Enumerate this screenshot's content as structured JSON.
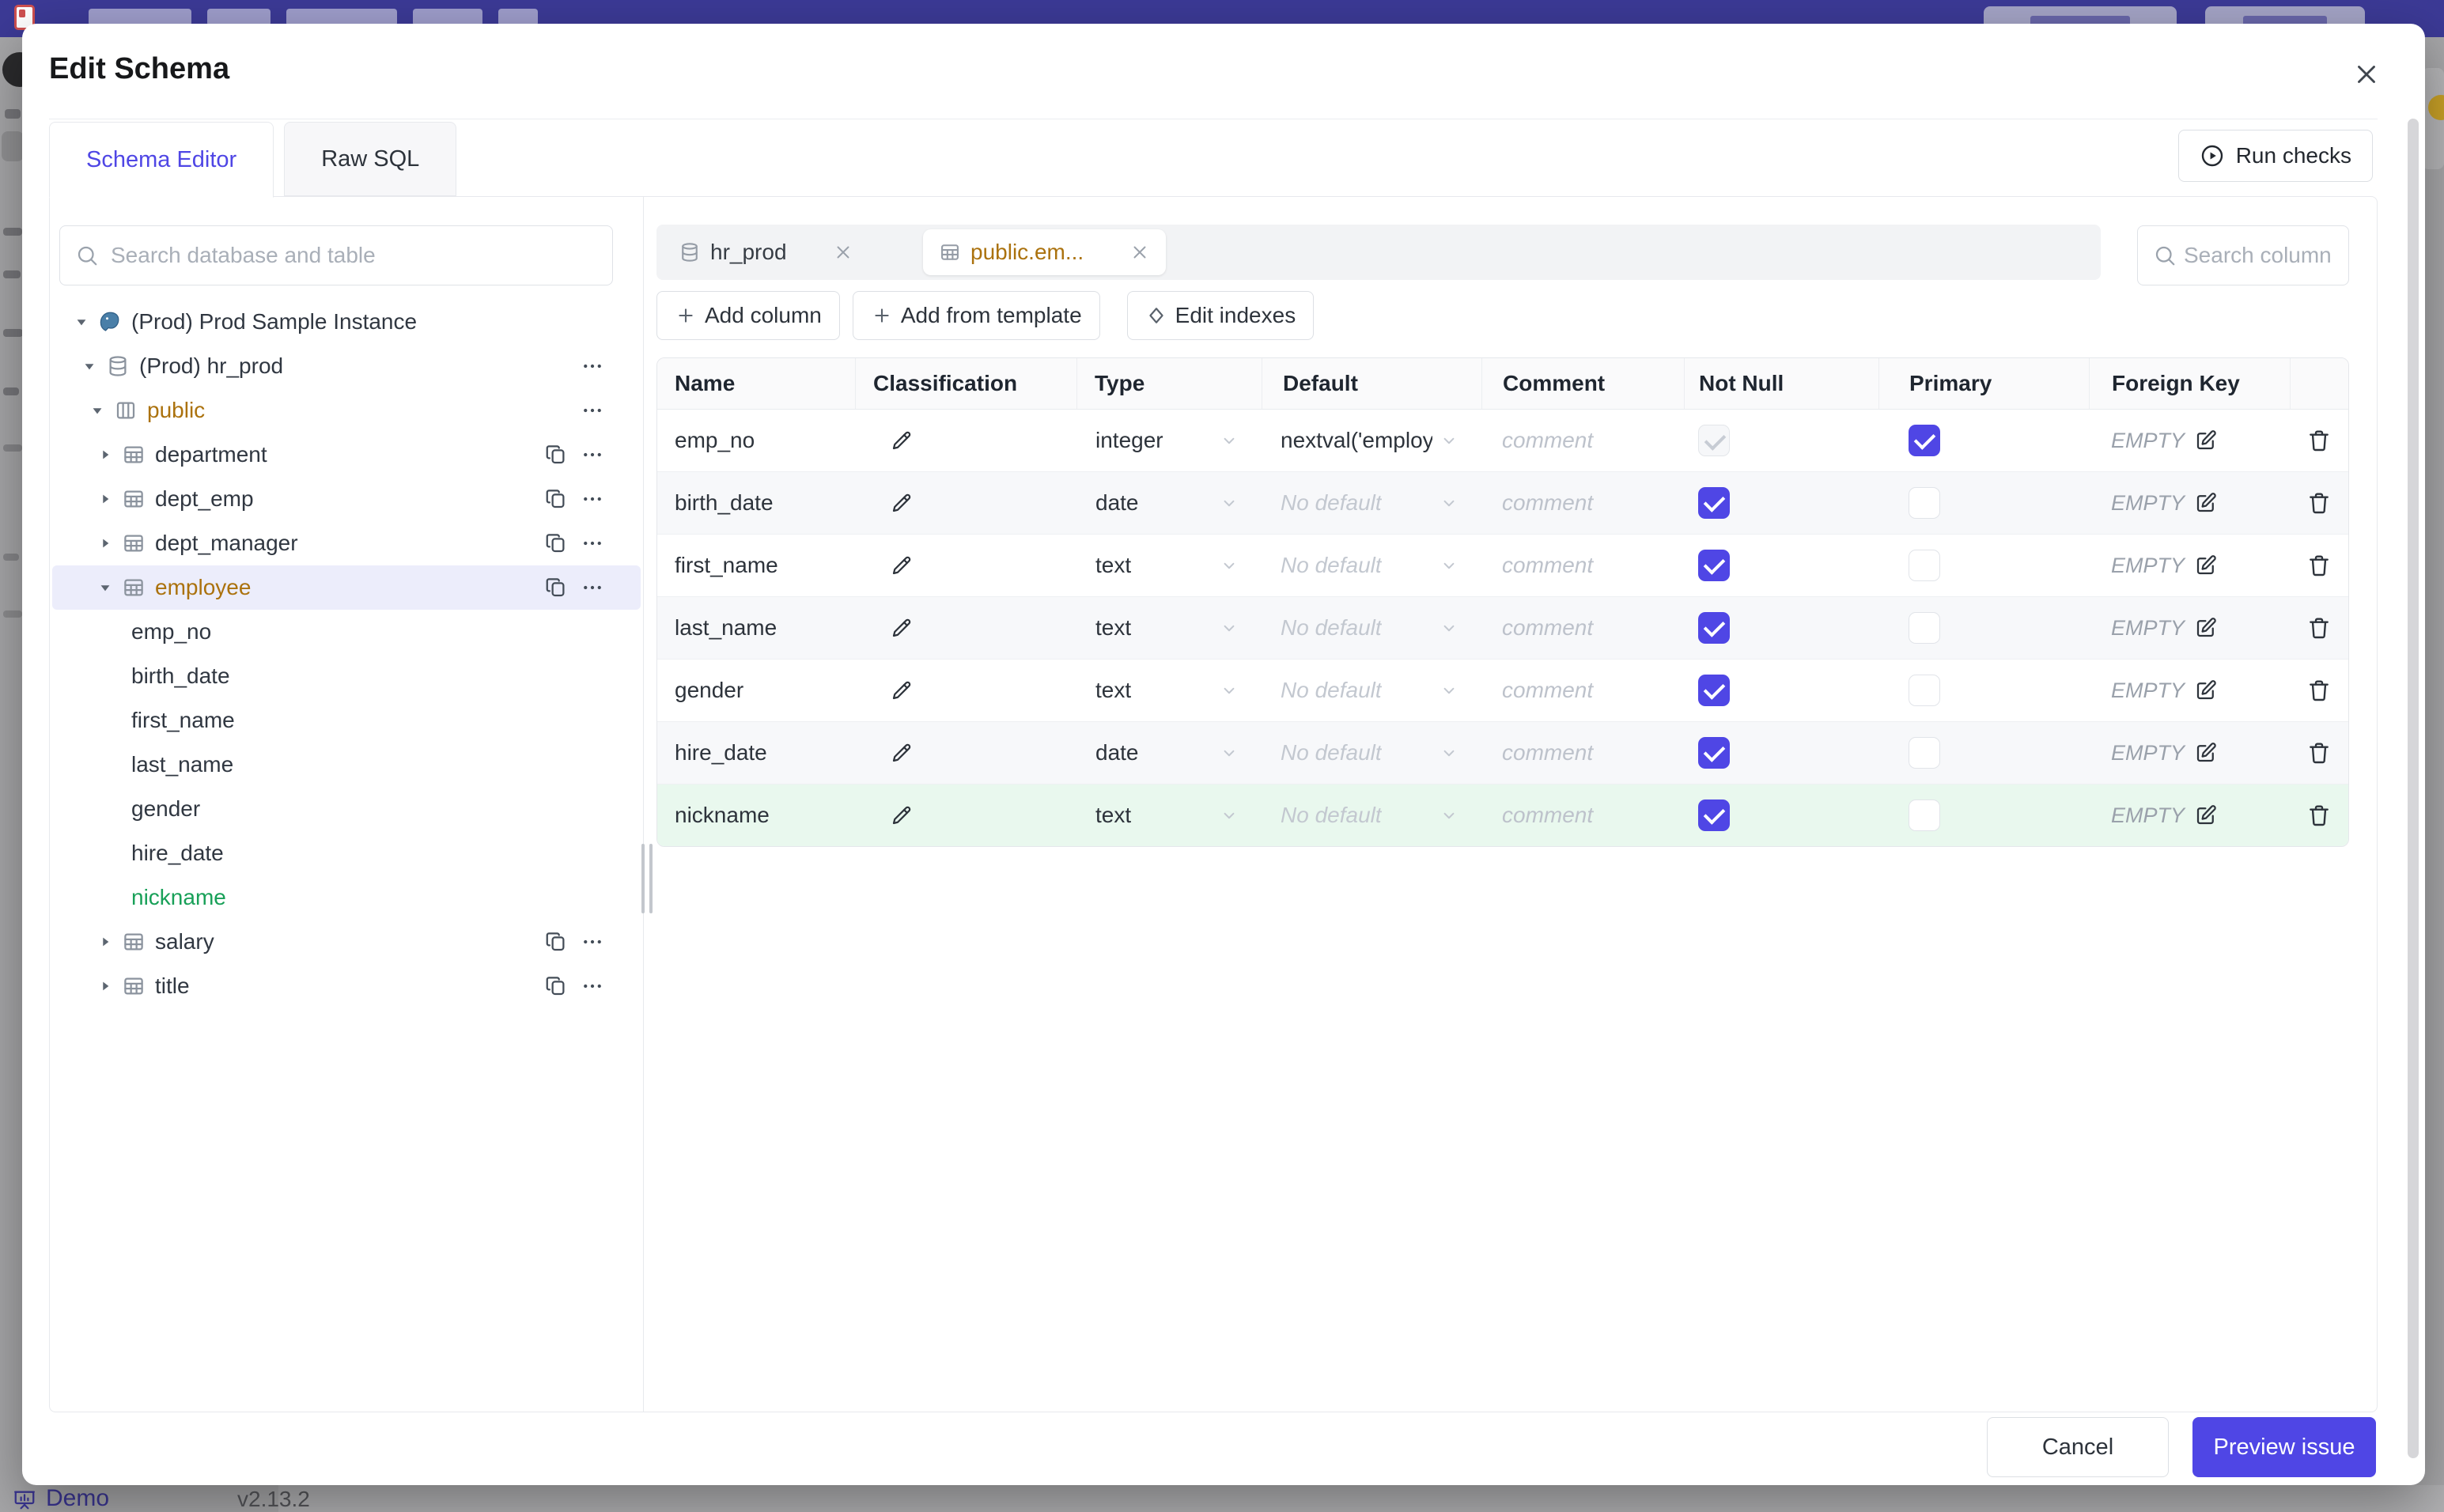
{
  "colors": {
    "accent": "#4f46e5",
    "amber": "#ab720e",
    "green": "#18a058",
    "selected_row_bg": "#ecedfb",
    "added_row_bg": "#e9f8ee",
    "top_bar": "#3c3a96"
  },
  "app": {
    "bottom_bar": {
      "demo_label": "Demo",
      "version": "v2.13.2"
    }
  },
  "modal": {
    "title": "Edit Schema",
    "tabs": [
      {
        "label": "Schema Editor",
        "active": true
      },
      {
        "label": "Raw SQL",
        "active": false
      }
    ],
    "run_checks_label": "Run checks",
    "sidebar": {
      "search_placeholder": "Search database and table",
      "tree": [
        {
          "label": "(Prod) Prod Sample Instance",
          "level": 1,
          "icon": "postgres",
          "caret": "down",
          "color": "default",
          "selected": false,
          "actions": []
        },
        {
          "label": "(Prod) hr_prod",
          "level": 2,
          "icon": "database",
          "caret": "down",
          "color": "default",
          "selected": false,
          "actions": [
            "more"
          ]
        },
        {
          "label": "public",
          "level": 3,
          "icon": "schema",
          "caret": "down",
          "color": "amber",
          "selected": false,
          "actions": [
            "more"
          ]
        },
        {
          "label": "department",
          "level": 4,
          "icon": "table",
          "caret": "right",
          "color": "default",
          "selected": false,
          "actions": [
            "copy",
            "more"
          ]
        },
        {
          "label": "dept_emp",
          "level": 4,
          "icon": "table",
          "caret": "right",
          "color": "default",
          "selected": false,
          "actions": [
            "copy",
            "more"
          ]
        },
        {
          "label": "dept_manager",
          "level": 4,
          "icon": "table",
          "caret": "right",
          "color": "default",
          "selected": false,
          "actions": [
            "copy",
            "more"
          ]
        },
        {
          "label": "employee",
          "level": 4,
          "icon": "table",
          "caret": "down",
          "color": "amber",
          "selected": true,
          "actions": [
            "copy",
            "more"
          ]
        },
        {
          "label": "emp_no",
          "level": "column",
          "icon": "",
          "caret": "",
          "color": "default",
          "selected": false,
          "actions": []
        },
        {
          "label": "birth_date",
          "level": "column",
          "icon": "",
          "caret": "",
          "color": "default",
          "selected": false,
          "actions": []
        },
        {
          "label": "first_name",
          "level": "column",
          "icon": "",
          "caret": "",
          "color": "default",
          "selected": false,
          "actions": []
        },
        {
          "label": "last_name",
          "level": "column",
          "icon": "",
          "caret": "",
          "color": "default",
          "selected": false,
          "actions": []
        },
        {
          "label": "gender",
          "level": "column",
          "icon": "",
          "caret": "",
          "color": "default",
          "selected": false,
          "actions": []
        },
        {
          "label": "hire_date",
          "level": "column",
          "icon": "",
          "caret": "",
          "color": "default",
          "selected": false,
          "actions": []
        },
        {
          "label": "nickname",
          "level": "column",
          "icon": "",
          "caret": "",
          "color": "green",
          "selected": false,
          "actions": []
        },
        {
          "label": "salary",
          "level": 4,
          "icon": "table",
          "caret": "right",
          "color": "default",
          "selected": false,
          "actions": [
            "copy",
            "more"
          ]
        },
        {
          "label": "title",
          "level": 4,
          "icon": "table",
          "caret": "right",
          "color": "default",
          "selected": false,
          "actions": [
            "copy",
            "more"
          ]
        }
      ]
    },
    "editor": {
      "tabs": [
        {
          "label": "hr_prod",
          "icon": "database",
          "active": false
        },
        {
          "label": "public.em...",
          "icon": "table",
          "active": true
        }
      ],
      "toolbar": {
        "add_column": "Add column",
        "add_from_template": "Add from template",
        "edit_indexes": "Edit indexes"
      },
      "column_search_placeholder": "Search column",
      "table": {
        "headers": [
          "Name",
          "Classification",
          "Type",
          "Default",
          "Comment",
          "Not Null",
          "Primary",
          "Foreign Key"
        ],
        "comment_placeholder": "comment",
        "foreign_key_empty": "EMPTY",
        "rows": [
          {
            "name": "emp_no",
            "type": "integer",
            "default": "nextval('employ",
            "has_default": true,
            "not_null": "checked-disabled",
            "primary": "checked",
            "added": false
          },
          {
            "name": "birth_date",
            "type": "date",
            "default": "No default",
            "has_default": false,
            "not_null": "checked",
            "primary": "unchecked",
            "added": false
          },
          {
            "name": "first_name",
            "type": "text",
            "default": "No default",
            "has_default": false,
            "not_null": "checked",
            "primary": "unchecked",
            "added": false
          },
          {
            "name": "last_name",
            "type": "text",
            "default": "No default",
            "has_default": false,
            "not_null": "checked",
            "primary": "unchecked",
            "added": false
          },
          {
            "name": "gender",
            "type": "text",
            "default": "No default",
            "has_default": false,
            "not_null": "checked",
            "primary": "unchecked",
            "added": false
          },
          {
            "name": "hire_date",
            "type": "date",
            "default": "No default",
            "has_default": false,
            "not_null": "checked",
            "primary": "unchecked",
            "added": false
          },
          {
            "name": "nickname",
            "type": "text",
            "default": "No default",
            "has_default": false,
            "not_null": "checked",
            "primary": "unchecked",
            "added": true
          }
        ]
      }
    },
    "footer": {
      "cancel_label": "Cancel",
      "submit_label": "Preview issue"
    }
  }
}
